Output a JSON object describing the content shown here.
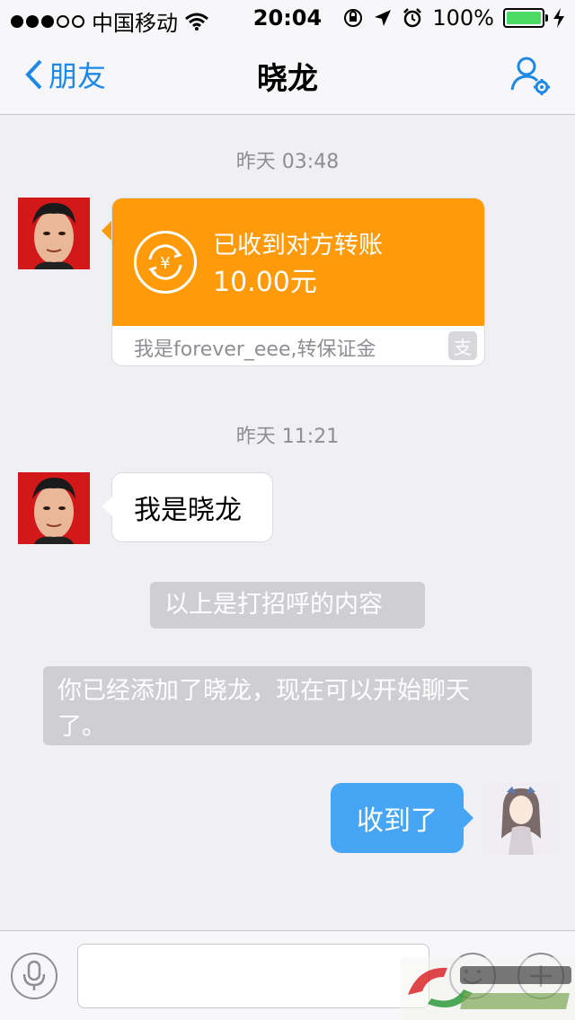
{
  "status_bar": {
    "carrier": "中国移动",
    "time": "20:04",
    "battery": "100%"
  },
  "nav": {
    "back_label": "朋友",
    "title": "晓龙"
  },
  "messages": {
    "ts1": "昨天 03:48",
    "transfer": {
      "title": "已收到对方转账",
      "amount": "10.00元",
      "note": "我是forever_eee,转保证金",
      "logo_glyph": "支"
    },
    "ts2": "昨天 11:21",
    "incoming_text": "我是晓龙",
    "notice1": "以上是打招呼的内容",
    "notice2": "你已经添加了晓龙，现在可以开始聊天了。",
    "outgoing_text": "收到了"
  },
  "input": {
    "value": "",
    "placeholder": ""
  },
  "colors": {
    "accent_blue": "#1e88e5",
    "transfer_orange": "#ff9a0a",
    "outgoing_bubble": "#46a6f5",
    "background": "#efeff4"
  }
}
